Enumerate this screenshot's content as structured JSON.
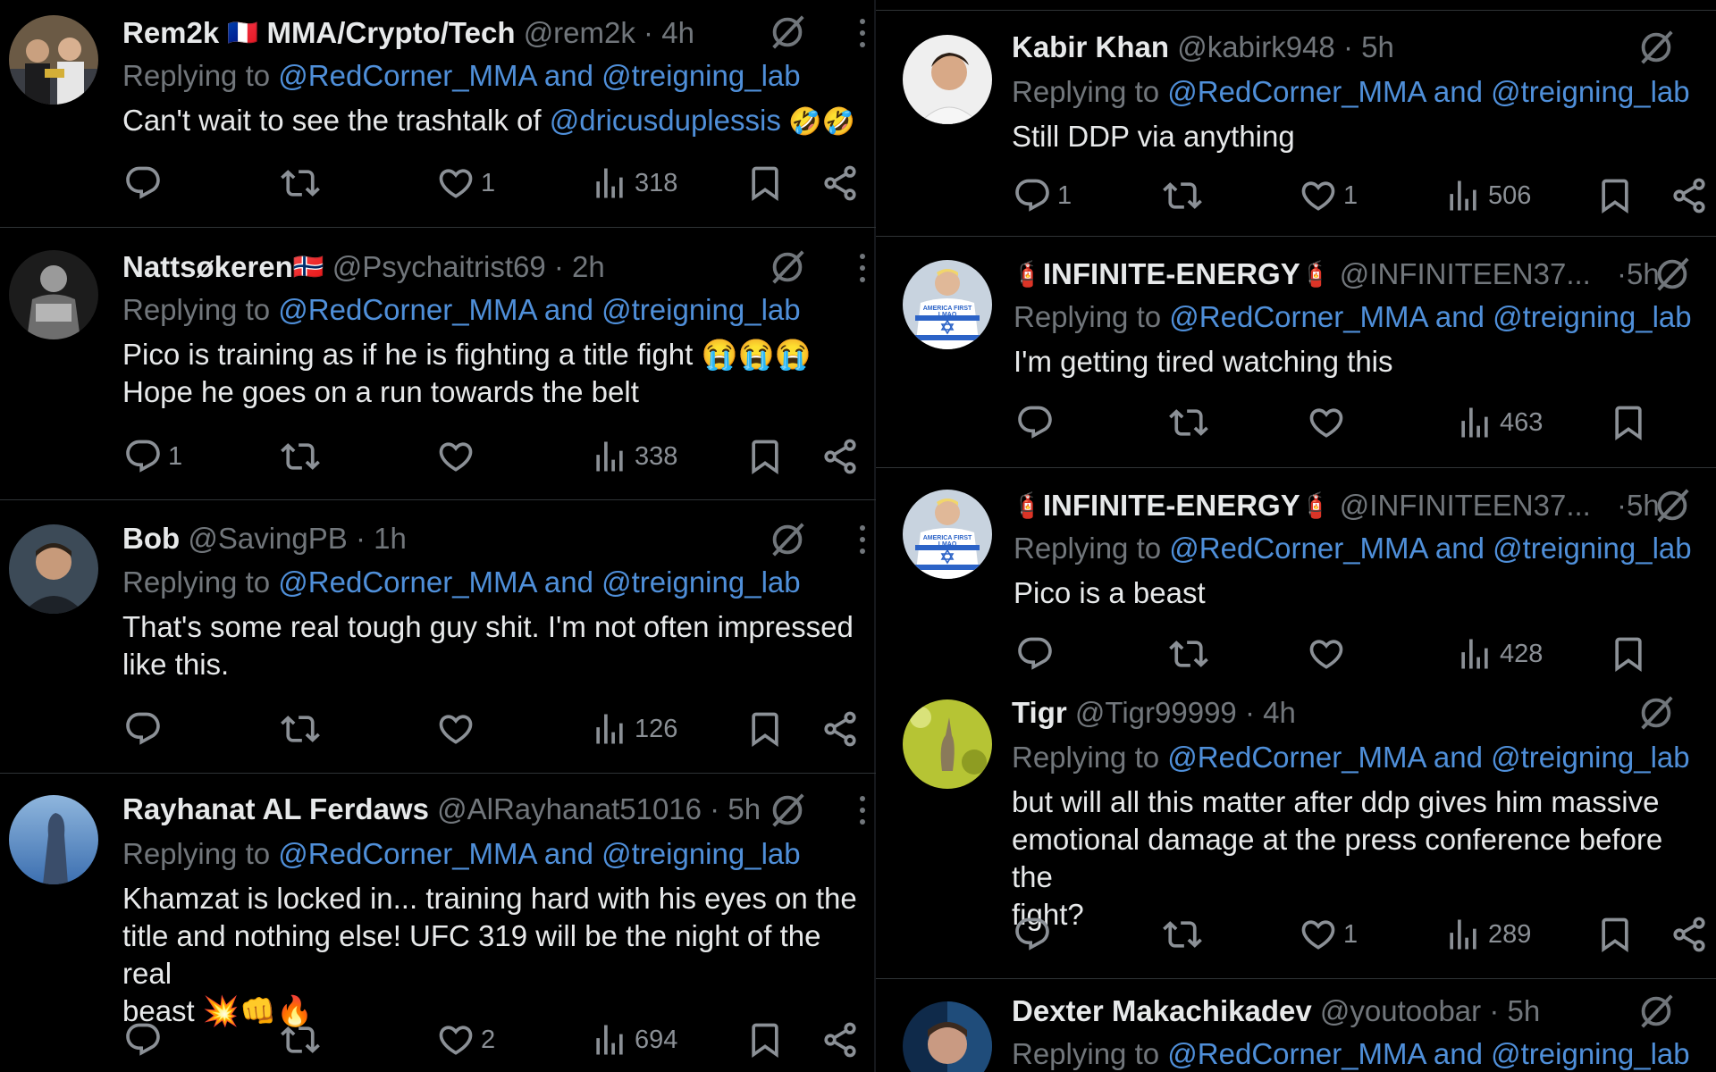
{
  "reply_prefix": "Replying to",
  "reply_targets": [
    "@RedCorner_MMA",
    "and",
    "@treigning_lab"
  ],
  "left_column": [
    {
      "name": "Rem2k",
      "name_emoji": "🇫🇷",
      "name_suffix": "MMA/Crypto/Tech",
      "handle": "@rem2k",
      "time": "4h",
      "text_before": "Can't wait to see the trashtalk of ",
      "mention": "@dricusduplessis",
      "text_after": " 🤣🤣",
      "replies": "",
      "likes": "1",
      "views": "318"
    },
    {
      "name": "Nattsøkeren",
      "name_emoji": "🇳🇴",
      "handle": "@Psychaitrist69",
      "time": "2h",
      "text_lines": [
        "Pico is training as if he is fighting a title fight 😭😭😭",
        "Hope he goes on a run towards the belt"
      ],
      "replies": "1",
      "likes": "",
      "views": "338"
    },
    {
      "name": "Bob",
      "handle": "@SavingPB",
      "time": "1h",
      "text_lines": [
        "That's some real tough guy shit. I'm not often impressed",
        "like this."
      ],
      "replies": "",
      "likes": "",
      "views": "126"
    },
    {
      "name": "Rayhanat AL Ferdaws",
      "handle": "@AlRayhanat51016",
      "time": "5h",
      "text_lines": [
        "Khamzat is locked in... training hard with his eyes on the",
        "title and nothing else! UFC 319 will be the night of the real",
        "beast 💥👊🔥"
      ],
      "replies": "",
      "likes": "2",
      "views": "694"
    }
  ],
  "right_column": [
    {
      "name": "Kabir Khan",
      "handle": "@kabirk948",
      "time": "5h",
      "text_lines": [
        "Still DDP via anything"
      ],
      "replies": "1",
      "likes": "1",
      "views": "506"
    },
    {
      "name": "INFINITE-ENERGY",
      "name_emoji": "🧯",
      "handle": "@INFINITEEN37...",
      "time": "5h",
      "text_lines": [
        "I'm getting tired watching this"
      ],
      "replies": "",
      "likes": "",
      "views": "463"
    },
    {
      "name": "INFINITE-ENERGY",
      "name_emoji": "🧯",
      "handle": "@INFINITEEN37...",
      "time": "5h",
      "text_lines": [
        "Pico is a beast"
      ],
      "replies": "",
      "likes": "",
      "views": "428"
    },
    {
      "name": "Tigr",
      "handle": "@Tigr99999",
      "time": "4h",
      "text_lines": [
        "but will all this matter after ddp gives him massive",
        "emotional damage at the press conference before the",
        "fight?"
      ],
      "replies": "",
      "likes": "1",
      "views": "289"
    },
    {
      "name": "Dexter Makachikadev",
      "handle": "@youtoobar",
      "time": "5h"
    }
  ],
  "avatar_texts": {
    "shirt": "AMERICA FIRST\nLMAO"
  },
  "colors": {
    "background": "#000000",
    "text": "#e7e9ea",
    "muted": "#71767b",
    "link": "#4f8fd9",
    "border": "#2f3336"
  }
}
